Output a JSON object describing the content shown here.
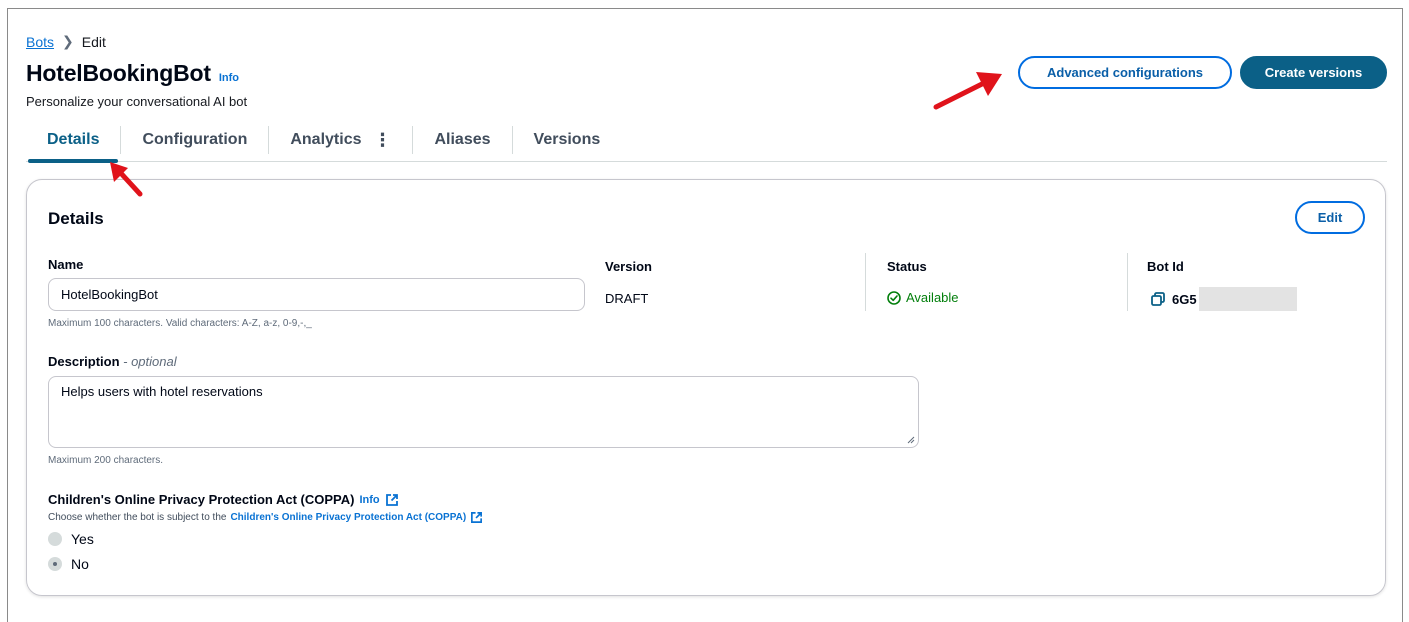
{
  "breadcrumb": {
    "root": "Bots",
    "current": "Edit"
  },
  "header": {
    "title": "HotelBookingBot",
    "info": "Info",
    "subtitle": "Personalize your conversational AI bot",
    "advanced_label": "Advanced configurations",
    "create_versions_label": "Create versions"
  },
  "tabs": [
    {
      "label": "Details",
      "active": true
    },
    {
      "label": "Configuration"
    },
    {
      "label": "Analytics"
    },
    {
      "label": "Aliases"
    },
    {
      "label": "Versions"
    }
  ],
  "details": {
    "title": "Details",
    "edit_label": "Edit",
    "name_label": "Name",
    "name_value": "HotelBookingBot",
    "name_hint": "Maximum 100 characters. Valid characters: A-Z, a-z, 0-9,-,_",
    "version_label": "Version",
    "version_value": "DRAFT",
    "status_label": "Status",
    "status_value": "Available",
    "botid_label": "Bot Id",
    "botid_value": "6G5",
    "description_label": "Description",
    "description_optional": "- optional",
    "description_value": "Helps users  with hotel reservations",
    "description_hint": "Maximum 200 characters.",
    "coppa_title": "Children's Online Privacy Protection Act (COPPA)",
    "coppa_info": "Info",
    "coppa_desc_prefix": "Choose whether the bot is subject to the",
    "coppa_desc_link": "Children's Online Privacy Protection Act (COPPA)",
    "radio_yes": "Yes",
    "radio_no": "No",
    "selected": "No"
  },
  "colors": {
    "primary": "#0b6087",
    "link": "#0972d3",
    "success": "#037f0c",
    "annotation_arrow": "#e0131b"
  }
}
